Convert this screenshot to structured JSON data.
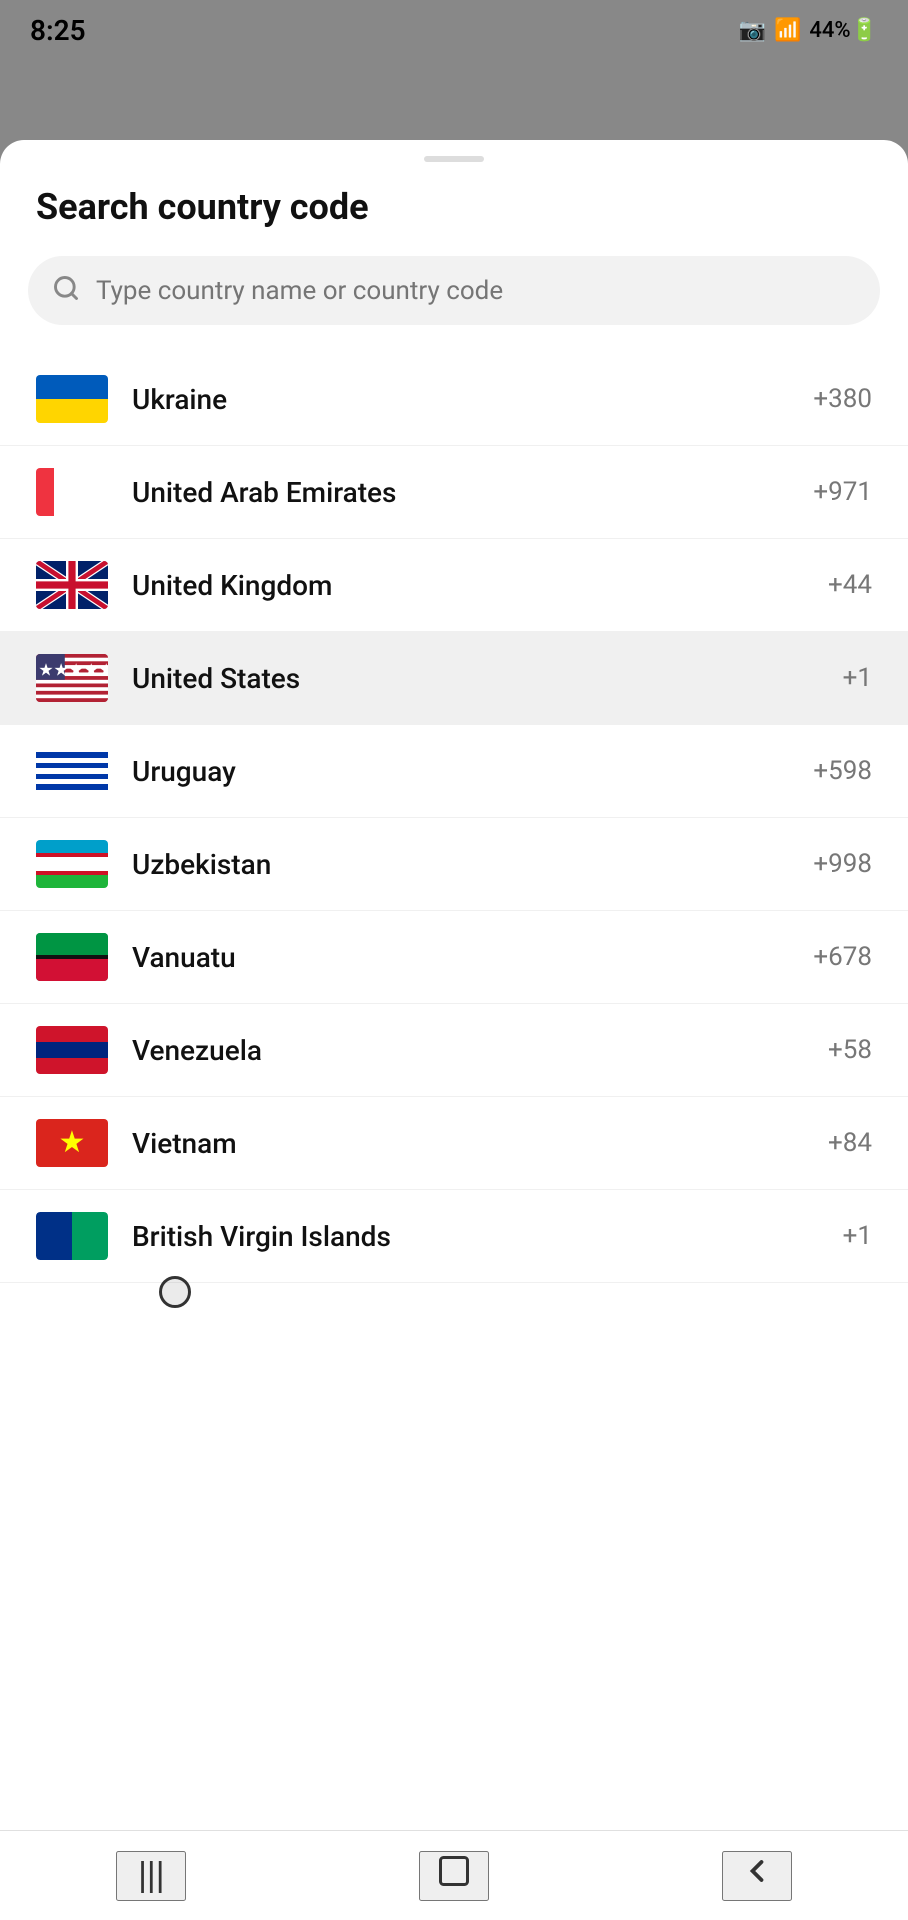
{
  "statusBar": {
    "time": "8:25",
    "battery": "44%",
    "signal": "●●●"
  },
  "sheet": {
    "title": "Search country code",
    "search": {
      "placeholder": "Type country name or country code"
    }
  },
  "countries": [
    {
      "name": "Ukraine",
      "code": "+380",
      "flagType": "ukraine",
      "highlighted": false
    },
    {
      "name": "United Arab Emirates",
      "code": "+971",
      "flagType": "uae",
      "highlighted": false
    },
    {
      "name": "United Kingdom",
      "code": "+44",
      "flagType": "uk",
      "highlighted": false
    },
    {
      "name": "United States",
      "code": "+1",
      "flagType": "us",
      "highlighted": true
    },
    {
      "name": "Uruguay",
      "code": "+598",
      "flagType": "uruguay",
      "highlighted": false
    },
    {
      "name": "Uzbekistan",
      "code": "+998",
      "flagType": "uzbekistan",
      "highlighted": false
    },
    {
      "name": "Vanuatu",
      "code": "+678",
      "flagType": "vanuatu",
      "highlighted": false
    },
    {
      "name": "Venezuela",
      "code": "+58",
      "flagType": "venezuela",
      "highlighted": false
    },
    {
      "name": "Vietnam",
      "code": "+84",
      "flagType": "vietnam",
      "highlighted": false
    },
    {
      "name": "British Virgin Islands",
      "code": "+1",
      "flagType": "bvi",
      "highlighted": false
    }
  ],
  "navBar": {
    "menu_icon": "|||",
    "home_icon": "□",
    "back_icon": "‹"
  }
}
